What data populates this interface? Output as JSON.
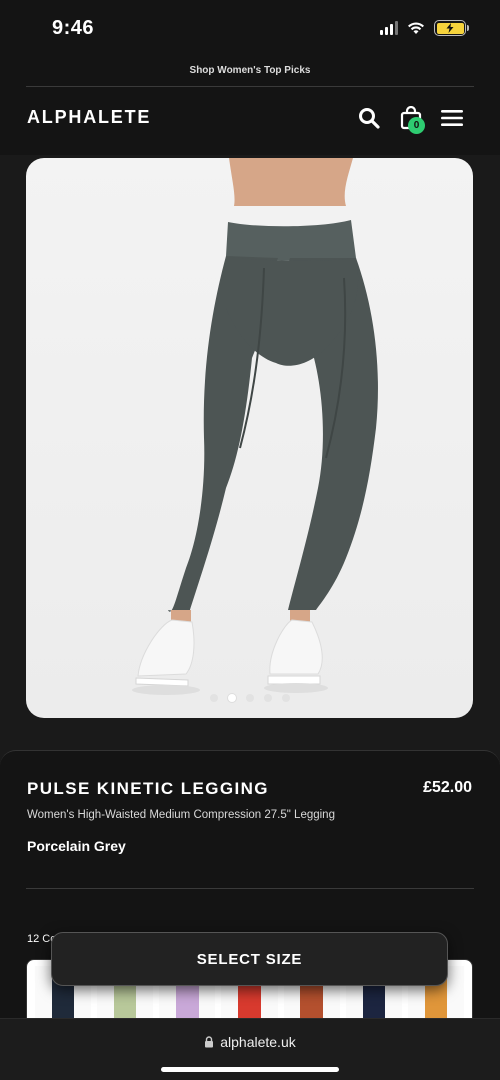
{
  "status_bar": {
    "time": "9:46"
  },
  "header": {
    "promo": "Shop Women's Top Picks",
    "logo": "ALPHALETE",
    "cart_count": "0",
    "icons": {
      "search": "search-icon",
      "bag": "shopping-bag-icon",
      "menu": "hamburger-menu-icon"
    }
  },
  "gallery": {
    "image_count": 5,
    "active_index": 1,
    "leggings_color": "#4d5554"
  },
  "product": {
    "name": "PULSE KINETIC LEGGING",
    "price": "£52.00",
    "subtitle": "Women's High-Waisted Medium Compression 27.5\" Legging",
    "color": "Porcelain Grey",
    "colours_label": "12 Co",
    "swatch_colors": [
      "#1f2a3a",
      "#b8c89a",
      "#c9a8d8",
      "#d83a2e",
      "#b4502e",
      "#1c2540",
      "#e0963a"
    ]
  },
  "cta": {
    "select_size": "SELECT SIZE"
  },
  "browser": {
    "url": "alphalete.uk"
  }
}
